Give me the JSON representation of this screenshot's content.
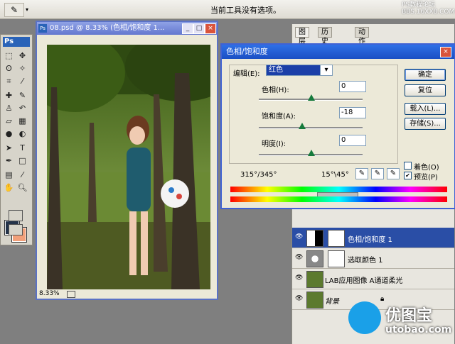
{
  "options_bar": {
    "message": "当前工具没有选项。",
    "watermark_line1": "PS教程论坛",
    "watermark_line2": "BBS.16XX8.COM"
  },
  "toolbox": {
    "logo": "Ps",
    "tools": [
      "move-icon",
      "marquee-icon",
      "lasso-icon",
      "magic-wand-icon",
      "crop-icon",
      "slice-icon",
      "healing-icon",
      "brush-icon",
      "stamp-icon",
      "history-brush-icon",
      "eraser-icon",
      "gradient-icon",
      "blur-icon",
      "dodge-icon",
      "pen-icon",
      "type-icon",
      "path-select-icon",
      "shape-icon",
      "notes-icon",
      "eyedropper-icon",
      "hand-icon",
      "zoom-icon"
    ],
    "foreground_color": "#24334a",
    "background_color": "#f2a07a"
  },
  "document": {
    "title": "08.psd @ 8.33% (色相/饱和度 1...",
    "zoom": "8.33%",
    "minimize": "_",
    "maximize": "□",
    "close": "×"
  },
  "layers_panel": {
    "tabs": [
      "图层",
      "历史记录",
      "动作"
    ],
    "layers": [
      {
        "name": "色相/饱和度 1",
        "selected": true
      },
      {
        "name": "选取颜色 1",
        "selected": false
      },
      {
        "name": "LAB应用图像 A通道柔光",
        "selected": false
      },
      {
        "name": "背景",
        "selected": false
      }
    ]
  },
  "dialog": {
    "title": "色相/饱和度",
    "edit_label": "编辑(E):",
    "edit_value": "红色",
    "hue_label": "色相(H):",
    "hue_value": "0",
    "saturation_label": "饱和度(A):",
    "saturation_value": "-18",
    "lightness_label": "明度(I):",
    "lightness_value": "0",
    "range_left": "315°/345°",
    "range_right": "15°\\45°",
    "ok": "确定",
    "reset": "复位",
    "load": "载入(L)...",
    "save": "存储(S)...",
    "colorize": "着色(O)",
    "preview": "预览(P)",
    "preview_checked": true,
    "colorize_checked": false
  },
  "watermark": {
    "cn": "优图宝",
    "en": "utobao.com"
  }
}
